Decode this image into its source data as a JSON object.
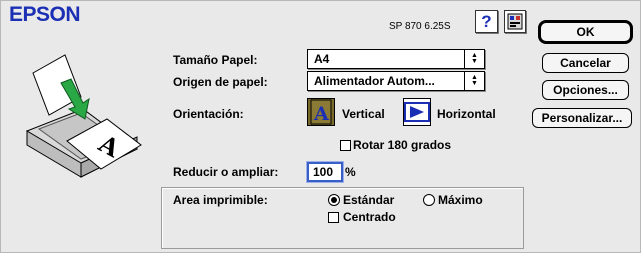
{
  "header": {
    "brand": "EPSON",
    "version": "SP 870 6.25S",
    "help_label": "?"
  },
  "buttons": {
    "ok": "OK",
    "cancel": "Cancelar",
    "options": "Opciones...",
    "customize": "Personalizar..."
  },
  "paper_size": {
    "label": "Tamaño Papel:",
    "value": "A4"
  },
  "paper_source": {
    "label": "Origen de papel:",
    "value": "Alimentador Autom..."
  },
  "orientation": {
    "label": "Orientación:",
    "vertical": "Vertical",
    "horizontal": "Horizontal",
    "selected": "vertical"
  },
  "rotate": {
    "label": "Rotar 180 grados",
    "checked": false
  },
  "scale": {
    "label": "Reducir o ampliar:",
    "value": "100",
    "unit": "%"
  },
  "printable_area": {
    "label": "Area imprimible:",
    "standard": "Estándar",
    "maximum": "Máximo",
    "selected": "standard",
    "centered": "Centrado",
    "centered_checked": false
  },
  "colors": {
    "brand": "#1a2fb4",
    "focus": "#3a5ec8"
  }
}
